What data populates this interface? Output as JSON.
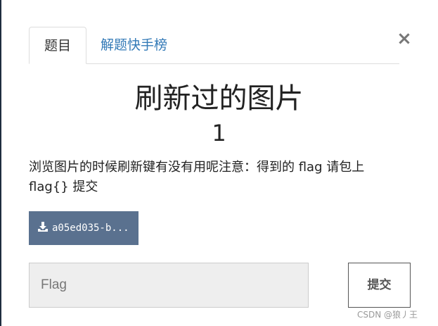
{
  "tabs": [
    {
      "label": "题目"
    },
    {
      "label": "解题快手榜"
    }
  ],
  "close_icon": "close-icon",
  "challenge": {
    "title": "刷新过的图片",
    "points": "1",
    "description": "浏览图片的时候刷新键有没有用呢注意：得到的 flag 请包上 flag{} 提交"
  },
  "download": {
    "icon": "download-icon",
    "filename": "a05ed035-b..."
  },
  "flag_form": {
    "placeholder": "Flag",
    "submit_label": "提交"
  },
  "watermark": "CSDN @狼丿王",
  "colors": {
    "download_bg": "#5a718f",
    "tab_link": "#337ab7"
  }
}
